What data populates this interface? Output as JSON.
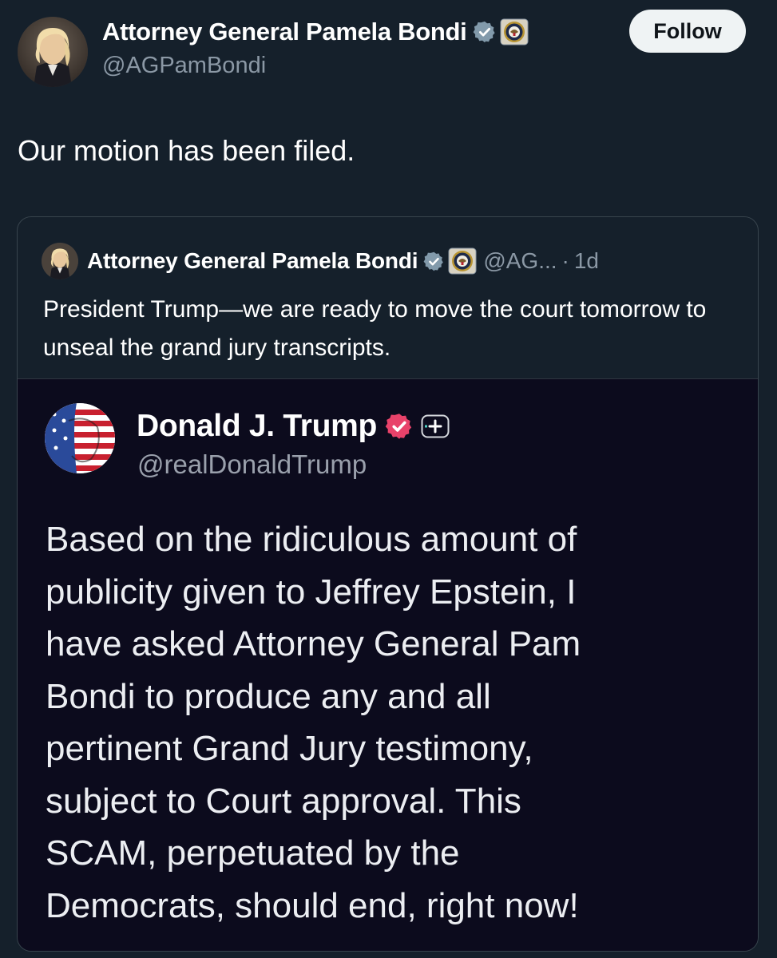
{
  "post": {
    "author": {
      "display_name": "Attorney General Pamela Bondi",
      "handle": "@AGPamBondi",
      "verified_icon": "gray-verified-badge-icon",
      "affiliation_icon": "doj-seal-icon"
    },
    "follow_label": "Follow",
    "text": "Our motion has been filed."
  },
  "quote": {
    "author": {
      "display_name": "Attorney General Pamela Bondi",
      "handle": "@AG...",
      "separator": "·",
      "time": "1d"
    },
    "text": "President Trump—we are ready to move the court tomorrow to unseal the grand jury transcripts.",
    "embedded_truth": {
      "display_name": "Donald J. Trump",
      "handle": "@realDonaldTrump",
      "verified_color": "#e8426a",
      "lines": [
        "Based on the ridiculous amount of",
        "publicity given to Jeffrey Epstein, I",
        "have asked Attorney General Pam",
        "Bondi to produce any and all",
        "pertinent Grand Jury testimony,",
        "subject to Court approval. This",
        "SCAM, perpetuated by the",
        "Democrats, should end, right now!"
      ]
    }
  },
  "colors": {
    "background": "#15202b",
    "secondary_text": "#8b98a5",
    "border": "#38444d",
    "embedded_background": "#0c0b1d"
  }
}
